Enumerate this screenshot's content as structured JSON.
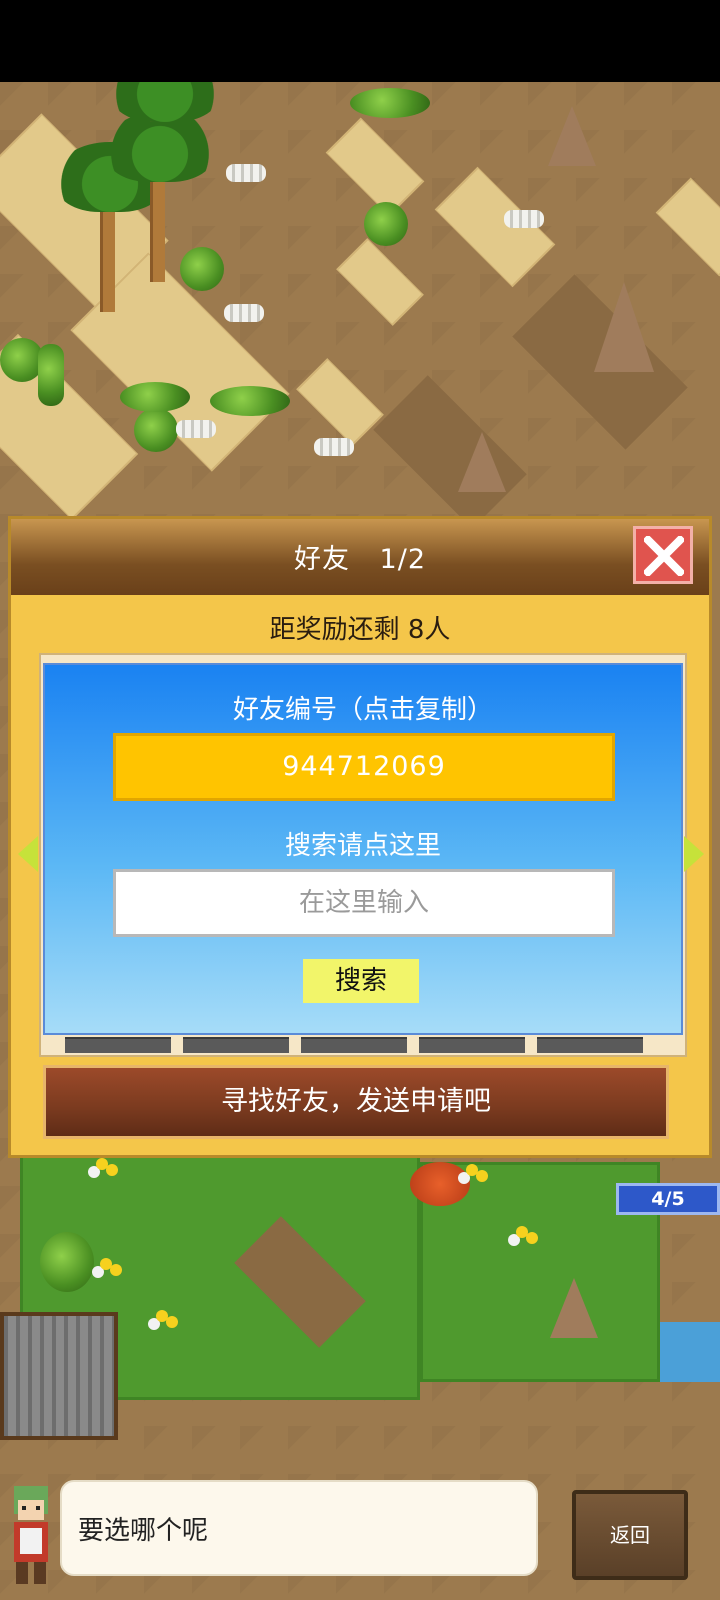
{
  "dialog": {
    "title": "好友 1/2",
    "reward_text": "距奖励还剩 8人",
    "friend_id_label": "好友编号（点击复制）",
    "friend_id": "944712069",
    "search_label": "搜索请点这里",
    "search_placeholder": "在这里输入",
    "search_button": "搜索",
    "find_friends_button": "寻找好友，发送申请吧"
  },
  "progress_badge": "4/5",
  "speech": {
    "text": "要选哪个呢"
  },
  "back_button": "返回",
  "icons": {
    "close": "close-icon",
    "prev": "left-arrow-icon",
    "next": "right-arrow-icon"
  },
  "colors": {
    "panel_blue": "#1a82f2",
    "id_box_yellow": "#ffc400",
    "close_red": "#e0544e",
    "search_button": "#f2f56a",
    "find_button_brown": "#7a3a1f"
  }
}
